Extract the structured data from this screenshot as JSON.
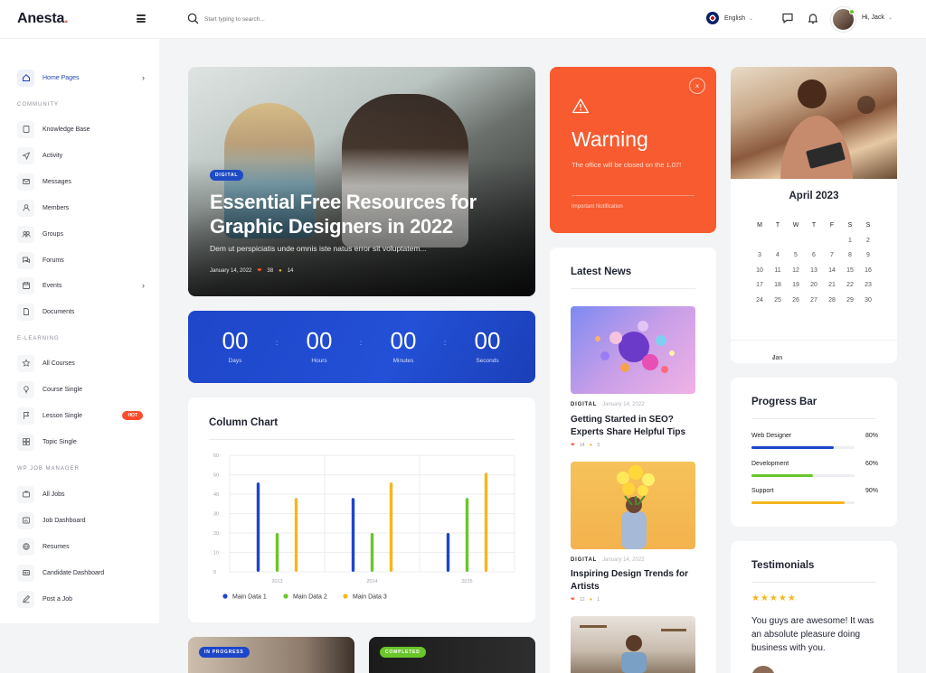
{
  "header": {
    "logo_text": "Anesta",
    "logo_dot": ".",
    "search_placeholder": "Start typing to search...",
    "language": "English",
    "greeting": "Hi, Jack"
  },
  "sidebar": {
    "home": "Home Pages",
    "sections": {
      "community": "COMMUNITY",
      "elearning": "E-LEARNING",
      "jobs": "WP JOB MANAGER"
    },
    "community_items": [
      "Knowledge Base",
      "Activity",
      "Messages",
      "Members",
      "Groups",
      "Forums",
      "Events",
      "Documents"
    ],
    "elearning_items": [
      "All Courses",
      "Course Single",
      "Lesson Single",
      "Topic Single"
    ],
    "hot_label": "HOT",
    "job_items": [
      "All Jobs",
      "Job Dashboard",
      "Resumes",
      "Candidate Dashboard",
      "Post a Job"
    ]
  },
  "hero": {
    "badge": "DIGITAL",
    "title": "Essential Free Resources for Graphic Designers in 2022",
    "subtitle": "Dem ut perspiciatis unde omnis iste natus error sit voluptatem...",
    "date": "January 14, 2022",
    "likes": "38",
    "comments": "14"
  },
  "countdown": {
    "days": "00",
    "days_label": "Days",
    "hours": "00",
    "hours_label": "Hours",
    "minutes": "00",
    "minutes_label": "Minutes",
    "seconds": "00",
    "seconds_label": "Seconds",
    "separator": ":"
  },
  "warning": {
    "title": "Warning",
    "text": "The office will be closed on the 1.07!",
    "note": "Important Notification",
    "close": "×"
  },
  "news": {
    "title": "Latest News",
    "items": [
      {
        "category": "DIGITAL",
        "date": "January 14, 2022",
        "headline": "Getting Started in SEO? Experts Share Helpful Tips",
        "likes": "14",
        "comments": "3"
      },
      {
        "category": "DIGITAL",
        "date": "January 14, 2022",
        "headline": "Inspiring Design Trends for Artists",
        "likes": "12",
        "comments": "1"
      }
    ]
  },
  "calendar": {
    "title": "April 2023",
    "weekdays": [
      "M",
      "T",
      "W",
      "T",
      "F",
      "S",
      "S"
    ],
    "days": [
      "",
      "",
      "",
      "",
      "",
      "1",
      "2",
      "3",
      "4",
      "5",
      "6",
      "7",
      "8",
      "9",
      "10",
      "11",
      "12",
      "13",
      "14",
      "15",
      "16",
      "17",
      "18",
      "19",
      "20",
      "21",
      "22",
      "23",
      "24",
      "25",
      "26",
      "27",
      "28",
      "29",
      "30"
    ],
    "prev_label": "Jan"
  },
  "progress": {
    "title": "Progress Bar",
    "items": [
      {
        "label": "Web Designer",
        "pct_label": "80%",
        "value": 0.8,
        "color": "#1e46c9"
      },
      {
        "label": "Development",
        "pct_label": "60%",
        "value": 0.6,
        "color": "#6ac62a"
      },
      {
        "label": "Support",
        "pct_label": "90%",
        "value": 0.9,
        "color": "#f4b71d"
      }
    ]
  },
  "testimonials": {
    "title": "Testimonials",
    "stars": "★★★★★",
    "text": "You guys are awesome! It was an absolute pleasure doing business with you."
  },
  "bottom_badges": {
    "left": "IN PROGRESS",
    "right": "COMPLETED"
  },
  "chart_data": {
    "type": "bar",
    "title": "Column Chart",
    "categories": [
      "2013",
      "2014",
      "2015"
    ],
    "series": [
      {
        "name": "Main Data 1",
        "color": "#1e46c9",
        "values": [
          46,
          38,
          20
        ]
      },
      {
        "name": "Main Data 2",
        "color": "#6ac62a",
        "values": [
          20,
          20,
          38
        ]
      },
      {
        "name": "Main Data 3",
        "color": "#f4b71d",
        "values": [
          38,
          46,
          51
        ]
      }
    ],
    "ylim": [
      0,
      60
    ],
    "yticks": [
      0,
      10,
      20,
      30,
      40,
      50,
      60
    ],
    "grid": true,
    "legend": "bottom"
  }
}
